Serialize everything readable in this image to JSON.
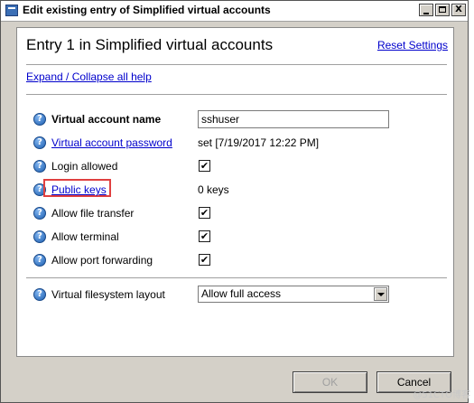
{
  "window": {
    "title": "Edit existing entry of Simplified virtual accounts",
    "controls": {
      "minimize": "_",
      "maximize": "□",
      "close": "X"
    }
  },
  "panel": {
    "heading": "Entry 1 in Simplified virtual accounts",
    "reset_link": "Reset Settings",
    "expand_link": "Expand / Collapse all help"
  },
  "fields": {
    "account_name": {
      "label": "Virtual account name",
      "value": "sshuser"
    },
    "account_password": {
      "label": "Virtual account password",
      "value": "set   [7/19/2017 12:22 PM]"
    },
    "login_allowed": {
      "label": "Login allowed",
      "checked": true
    },
    "public_keys": {
      "label": "Public keys",
      "value": "0 keys"
    },
    "allow_file_transfer": {
      "label": "Allow file transfer",
      "checked": true
    },
    "allow_terminal": {
      "label": "Allow terminal",
      "checked": true
    },
    "allow_port_forwarding": {
      "label": "Allow port forwarding",
      "checked": true
    },
    "filesystem_layout": {
      "label": "Virtual filesystem layout",
      "selected": "Allow full access"
    }
  },
  "buttons": {
    "ok": "OK",
    "cancel": "Cancel"
  },
  "help_icon_text": "?",
  "check_mark": "✔",
  "watermark": "@51CTO博客",
  "colors": {
    "link": "#0000cc",
    "highlight_box": "#e04040",
    "dialog_bg": "#d4d0c8"
  }
}
